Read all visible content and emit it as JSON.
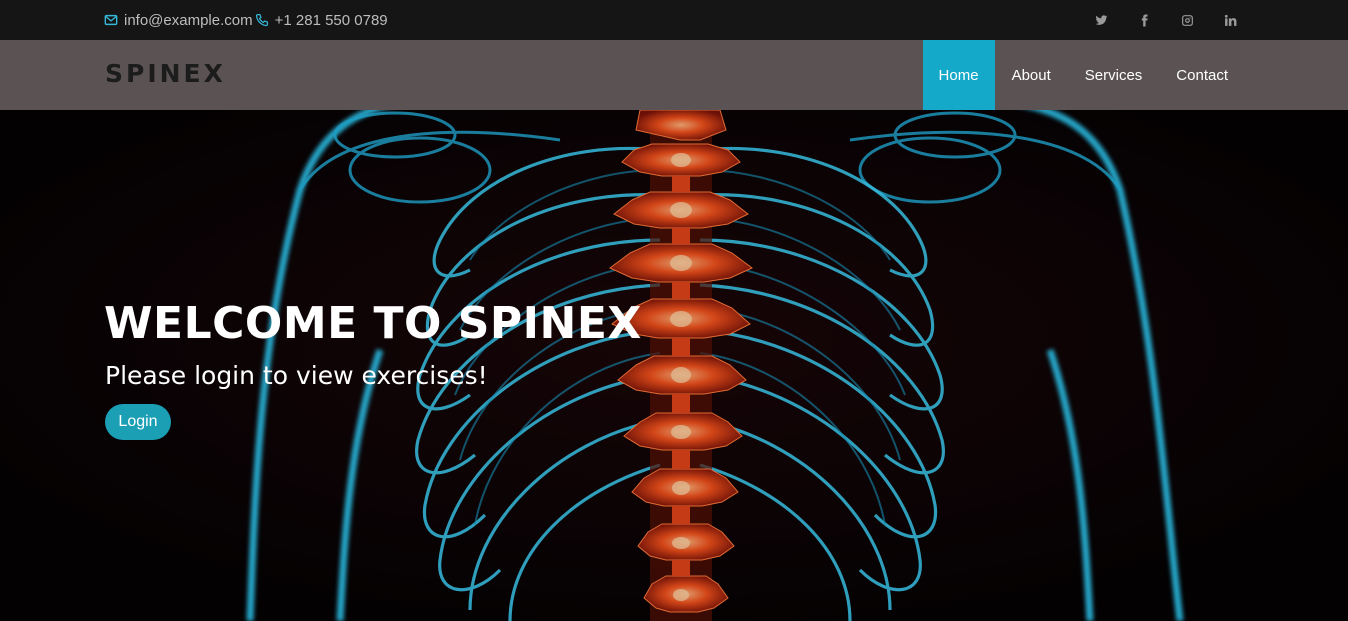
{
  "topbar": {
    "email": "info@example.com",
    "phone": "+1 281 550 0789",
    "social": [
      "twitter-icon",
      "facebook-icon",
      "instagram-icon",
      "linkedin-icon"
    ]
  },
  "header": {
    "logo": "SPINEX",
    "nav": [
      {
        "label": "Home",
        "active": true
      },
      {
        "label": "About",
        "active": false
      },
      {
        "label": "Services",
        "active": false
      },
      {
        "label": "Contact",
        "active": false
      }
    ]
  },
  "hero": {
    "title": "WELCOME TO SPINEX",
    "subtitle": "Please login to view exercises!",
    "login_label": "Login"
  },
  "colors": {
    "accent": "#14a9c9",
    "header_bg": "#5b5353",
    "topbar_bg": "#151515",
    "button": "#1b9fb5"
  }
}
